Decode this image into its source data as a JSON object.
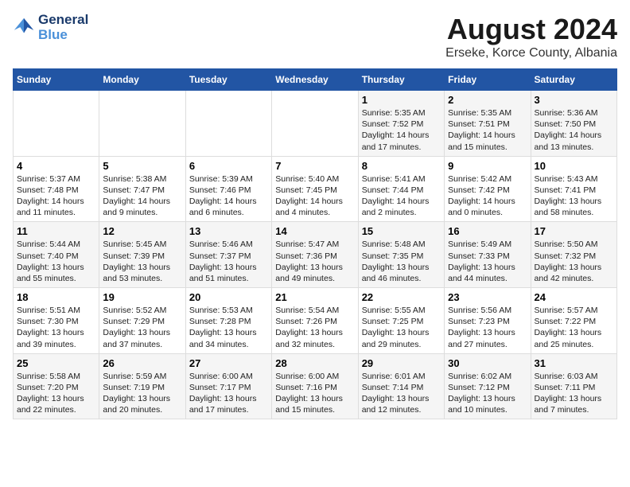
{
  "logo": {
    "line1": "General",
    "line2": "Blue"
  },
  "title": "August 2024",
  "location": "Erseke, Korce County, Albania",
  "days_header": [
    "Sunday",
    "Monday",
    "Tuesday",
    "Wednesday",
    "Thursday",
    "Friday",
    "Saturday"
  ],
  "weeks": [
    [
      {
        "day": "",
        "content": ""
      },
      {
        "day": "",
        "content": ""
      },
      {
        "day": "",
        "content": ""
      },
      {
        "day": "",
        "content": ""
      },
      {
        "day": "1",
        "content": "Sunrise: 5:35 AM\nSunset: 7:52 PM\nDaylight: 14 hours\nand 17 minutes."
      },
      {
        "day": "2",
        "content": "Sunrise: 5:35 AM\nSunset: 7:51 PM\nDaylight: 14 hours\nand 15 minutes."
      },
      {
        "day": "3",
        "content": "Sunrise: 5:36 AM\nSunset: 7:50 PM\nDaylight: 14 hours\nand 13 minutes."
      }
    ],
    [
      {
        "day": "4",
        "content": "Sunrise: 5:37 AM\nSunset: 7:48 PM\nDaylight: 14 hours\nand 11 minutes."
      },
      {
        "day": "5",
        "content": "Sunrise: 5:38 AM\nSunset: 7:47 PM\nDaylight: 14 hours\nand 9 minutes."
      },
      {
        "day": "6",
        "content": "Sunrise: 5:39 AM\nSunset: 7:46 PM\nDaylight: 14 hours\nand 6 minutes."
      },
      {
        "day": "7",
        "content": "Sunrise: 5:40 AM\nSunset: 7:45 PM\nDaylight: 14 hours\nand 4 minutes."
      },
      {
        "day": "8",
        "content": "Sunrise: 5:41 AM\nSunset: 7:44 PM\nDaylight: 14 hours\nand 2 minutes."
      },
      {
        "day": "9",
        "content": "Sunrise: 5:42 AM\nSunset: 7:42 PM\nDaylight: 14 hours\nand 0 minutes."
      },
      {
        "day": "10",
        "content": "Sunrise: 5:43 AM\nSunset: 7:41 PM\nDaylight: 13 hours\nand 58 minutes."
      }
    ],
    [
      {
        "day": "11",
        "content": "Sunrise: 5:44 AM\nSunset: 7:40 PM\nDaylight: 13 hours\nand 55 minutes."
      },
      {
        "day": "12",
        "content": "Sunrise: 5:45 AM\nSunset: 7:39 PM\nDaylight: 13 hours\nand 53 minutes."
      },
      {
        "day": "13",
        "content": "Sunrise: 5:46 AM\nSunset: 7:37 PM\nDaylight: 13 hours\nand 51 minutes."
      },
      {
        "day": "14",
        "content": "Sunrise: 5:47 AM\nSunset: 7:36 PM\nDaylight: 13 hours\nand 49 minutes."
      },
      {
        "day": "15",
        "content": "Sunrise: 5:48 AM\nSunset: 7:35 PM\nDaylight: 13 hours\nand 46 minutes."
      },
      {
        "day": "16",
        "content": "Sunrise: 5:49 AM\nSunset: 7:33 PM\nDaylight: 13 hours\nand 44 minutes."
      },
      {
        "day": "17",
        "content": "Sunrise: 5:50 AM\nSunset: 7:32 PM\nDaylight: 13 hours\nand 42 minutes."
      }
    ],
    [
      {
        "day": "18",
        "content": "Sunrise: 5:51 AM\nSunset: 7:30 PM\nDaylight: 13 hours\nand 39 minutes."
      },
      {
        "day": "19",
        "content": "Sunrise: 5:52 AM\nSunset: 7:29 PM\nDaylight: 13 hours\nand 37 minutes."
      },
      {
        "day": "20",
        "content": "Sunrise: 5:53 AM\nSunset: 7:28 PM\nDaylight: 13 hours\nand 34 minutes."
      },
      {
        "day": "21",
        "content": "Sunrise: 5:54 AM\nSunset: 7:26 PM\nDaylight: 13 hours\nand 32 minutes."
      },
      {
        "day": "22",
        "content": "Sunrise: 5:55 AM\nSunset: 7:25 PM\nDaylight: 13 hours\nand 29 minutes."
      },
      {
        "day": "23",
        "content": "Sunrise: 5:56 AM\nSunset: 7:23 PM\nDaylight: 13 hours\nand 27 minutes."
      },
      {
        "day": "24",
        "content": "Sunrise: 5:57 AM\nSunset: 7:22 PM\nDaylight: 13 hours\nand 25 minutes."
      }
    ],
    [
      {
        "day": "25",
        "content": "Sunrise: 5:58 AM\nSunset: 7:20 PM\nDaylight: 13 hours\nand 22 minutes."
      },
      {
        "day": "26",
        "content": "Sunrise: 5:59 AM\nSunset: 7:19 PM\nDaylight: 13 hours\nand 20 minutes."
      },
      {
        "day": "27",
        "content": "Sunrise: 6:00 AM\nSunset: 7:17 PM\nDaylight: 13 hours\nand 17 minutes."
      },
      {
        "day": "28",
        "content": "Sunrise: 6:00 AM\nSunset: 7:16 PM\nDaylight: 13 hours\nand 15 minutes."
      },
      {
        "day": "29",
        "content": "Sunrise: 6:01 AM\nSunset: 7:14 PM\nDaylight: 13 hours\nand 12 minutes."
      },
      {
        "day": "30",
        "content": "Sunrise: 6:02 AM\nSunset: 7:12 PM\nDaylight: 13 hours\nand 10 minutes."
      },
      {
        "day": "31",
        "content": "Sunrise: 6:03 AM\nSunset: 7:11 PM\nDaylight: 13 hours\nand 7 minutes."
      }
    ]
  ]
}
